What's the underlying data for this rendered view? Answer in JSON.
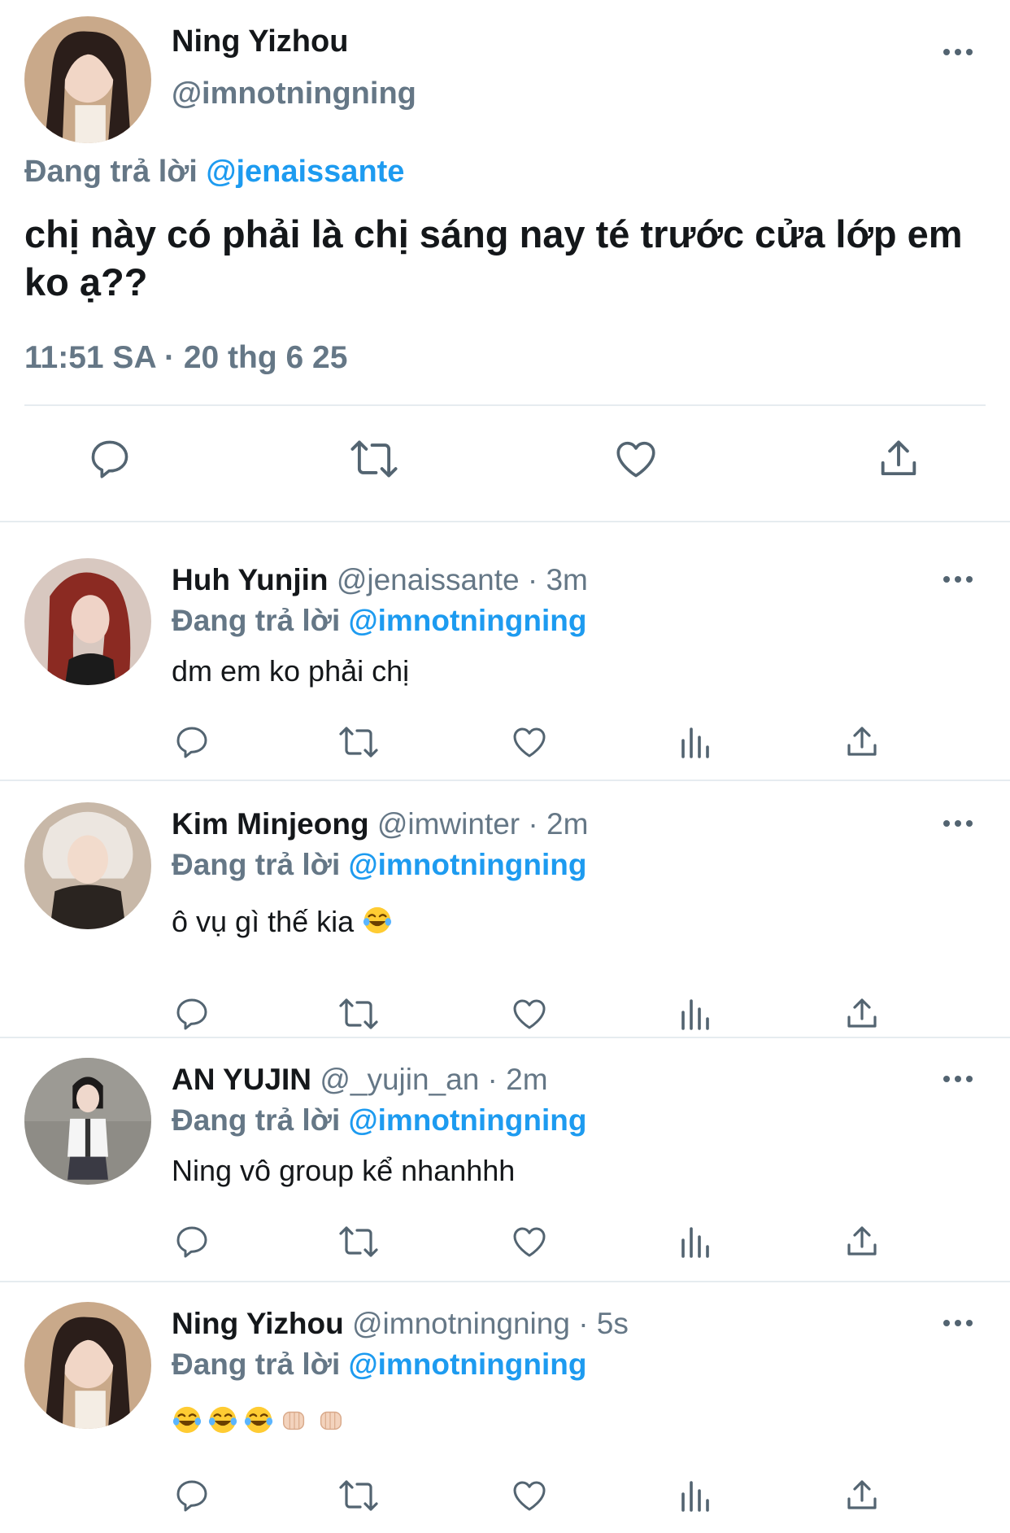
{
  "main_tweet": {
    "name": "Ning Yizhou",
    "handle": "@imnotningning",
    "replying_prefix": "Đang trả lời",
    "replying_to": "@jenaissante",
    "text": "chị này có phải là chị sáng nay té trước cửa lớp em ko ạ??",
    "timestamp": "11:51 SA · 20 thg 6 25"
  },
  "replies": [
    {
      "name": "Huh Yunjin",
      "meta": "@jenaissante · 3m",
      "replying_prefix": "Đang trả lời",
      "replying_to": "@imnotningning",
      "text": "dm em ko phải chị"
    },
    {
      "name": "Kim Minjeong",
      "meta": "@imwinter · 2m",
      "replying_prefix": "Đang trả lời",
      "replying_to": "@imnotningning",
      "text": "ô vụ gì thế kia"
    },
    {
      "name": "AN YUJIN",
      "meta": "@_yujin_an · 2m",
      "replying_prefix": "Đang trả lời",
      "replying_to": "@imnotningning",
      "text": "Ning vô group kể nhanhhh"
    },
    {
      "name": "Ning Yizhou",
      "meta": "@imnotningning · 5s",
      "replying_prefix": "Đang trả lời",
      "replying_to": "@imnotningning",
      "text": ""
    }
  ],
  "colors": {
    "accent": "#1d9bf0",
    "secondary_text": "#657786",
    "divider": "#e6ecf0",
    "icon": "#536471"
  },
  "icons": [
    "reply-icon",
    "retweet-icon",
    "like-icon",
    "views-icon",
    "share-icon",
    "more-icon",
    "laughing-emoji",
    "fist-bump-emoji"
  ]
}
